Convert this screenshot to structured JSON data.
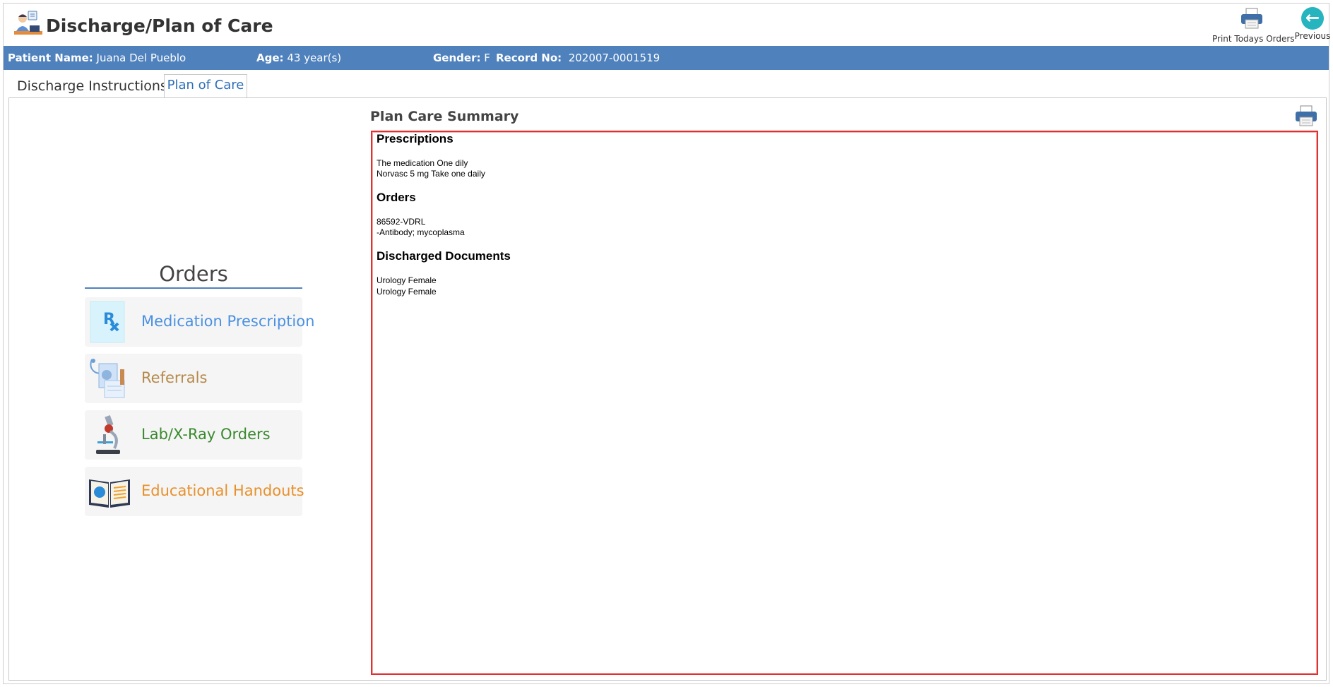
{
  "header": {
    "title": "Discharge/Plan of Care",
    "print_orders_label": "Print Todays Orders",
    "previous_label": "Previous"
  },
  "patient": {
    "name_label": "Patient Name:",
    "name_value": "Juana Del Pueblo",
    "age_label": "Age:",
    "age_value": "43 year(s)",
    "gender_label": "Gender:",
    "gender_value": "F",
    "record_label": "Record No:",
    "record_value": "202007-0001519"
  },
  "tabs": [
    {
      "label": "Discharge Instructions",
      "active": false
    },
    {
      "label": "Plan of Care",
      "active": true
    }
  ],
  "orders_menu": {
    "title": "Orders",
    "items": [
      {
        "label": "Medication Prescription",
        "color": "#4a90e2",
        "icon": "prescription-icon"
      },
      {
        "label": "Referrals",
        "color": "#b58a4a",
        "icon": "referrals-icon"
      },
      {
        "label": "Lab/X-Ray Orders",
        "color": "#3a8a2e",
        "icon": "microscope-icon"
      },
      {
        "label": "Educational Handouts",
        "color": "#e8902a",
        "icon": "book-icon"
      }
    ]
  },
  "summary": {
    "title": "Plan Care Summary",
    "sections": [
      {
        "heading": "Prescriptions",
        "lines": [
          "The medication One dily",
          "Norvasc 5 mg Take one daily"
        ]
      },
      {
        "heading": "Orders",
        "lines": [
          "86592-VDRL",
          "-Antibody; mycoplasma"
        ]
      },
      {
        "heading": "Discharged Documents",
        "lines": [
          "Urology Female",
          "Urology Female"
        ]
      }
    ]
  },
  "colors": {
    "patient_bar": "#4f81bd",
    "tab_active_text": "#2e6fb7",
    "summary_border": "#e03030",
    "previous_button": "#26b4bf"
  }
}
